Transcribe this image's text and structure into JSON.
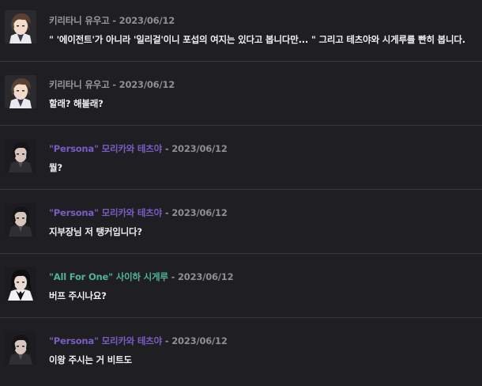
{
  "messages": [
    {
      "author": "키리타니 유우고",
      "separator": " - ",
      "date": "2023/06/12",
      "text": "\" '에이전트'가 아니라 '일리걸'이니 포섭의 여지는 있다고 봅니다만... \" 그리고 테츠야와 시게루를 빤히 봅니다.",
      "author_color": "#9a9a9f",
      "avatar_icon": "brown-hair-character-avatar"
    },
    {
      "author": "키리타니 유우고",
      "separator": " - ",
      "date": "2023/06/12",
      "text": "할래? 해볼래?",
      "author_color": "#9a9a9f",
      "avatar_icon": "brown-hair-character-avatar"
    },
    {
      "author": "\"Persona\" 모리카와 테츠야",
      "separator": " - ",
      "date": "2023/06/12",
      "text": "뭘?",
      "author_color": "#7b5cc4",
      "avatar_icon": "dark-hair-character-avatar"
    },
    {
      "author": "\"Persona\" 모리카와 테츠야",
      "separator": " - ",
      "date": "2023/06/12",
      "text": "지부장님 저 탱커입니다?",
      "author_color": "#7b5cc4",
      "avatar_icon": "dark-hair-character-avatar"
    },
    {
      "author": "\"All For One\" 사이하 시게루",
      "separator": " - ",
      "date": "2023/06/12",
      "text": "버프 주시나요?",
      "author_color": "#4fb39a",
      "avatar_icon": "black-hair-white-collar-avatar"
    },
    {
      "author": "\"Persona\" 모리카와 테츠야",
      "separator": " - ",
      "date": "2023/06/12",
      "text": "이왕 주시는 거 비트도",
      "author_color": "#7b5cc4",
      "avatar_icon": "dark-hair-character-avatar"
    }
  ]
}
